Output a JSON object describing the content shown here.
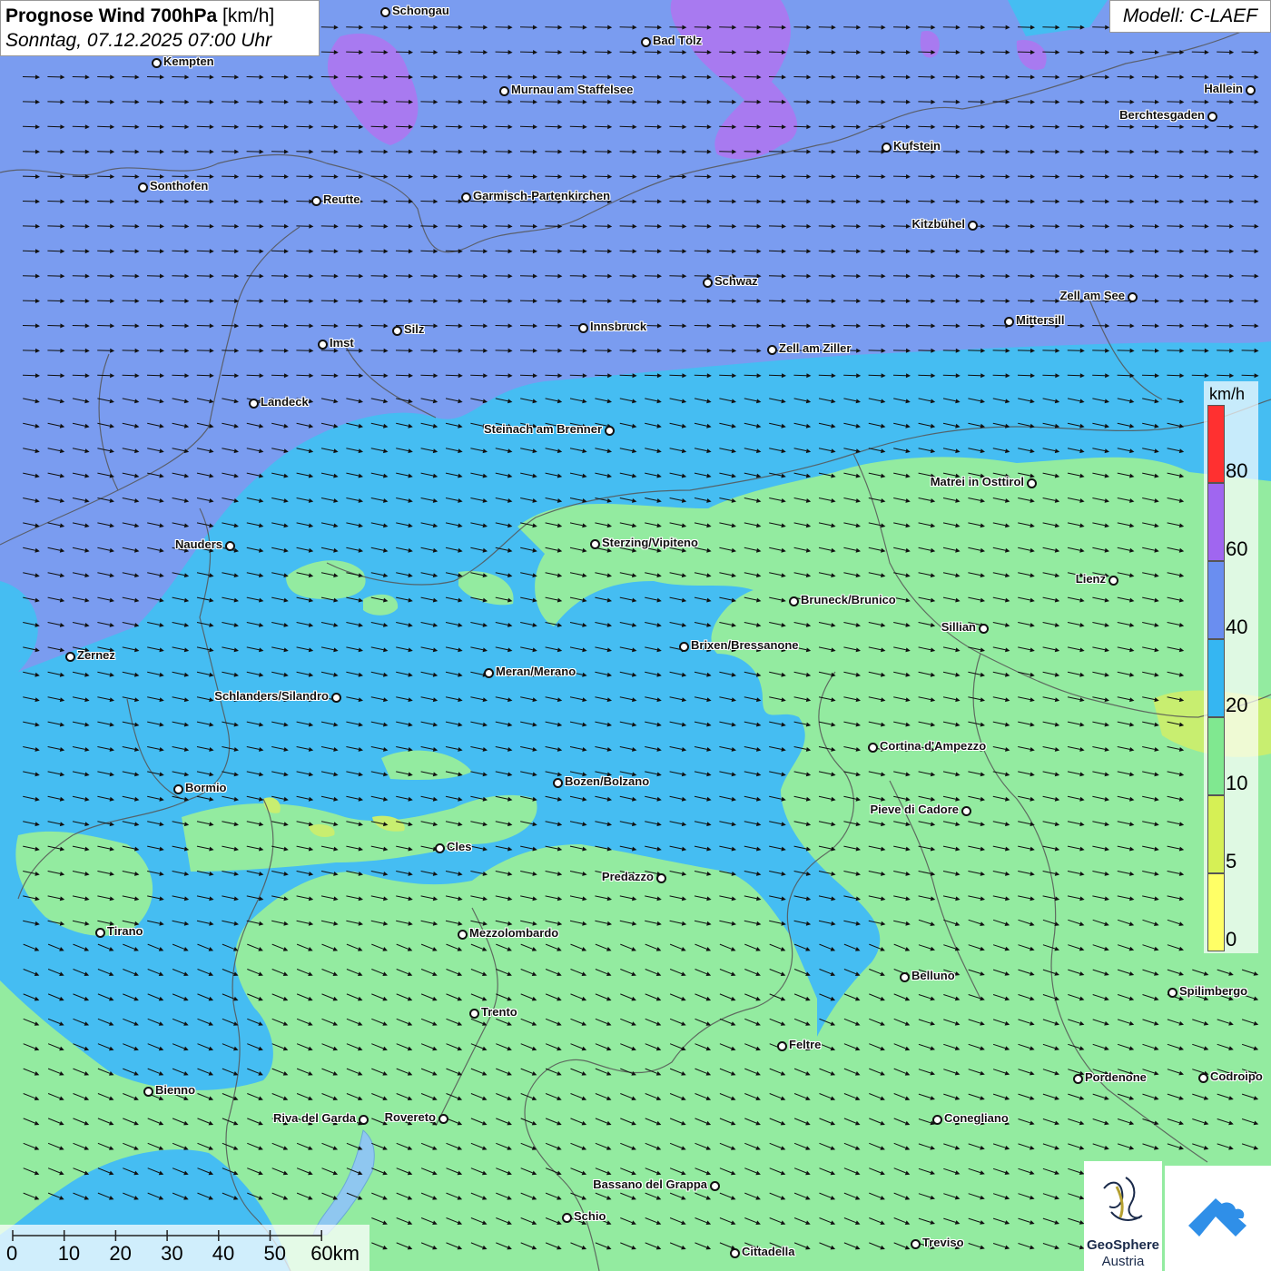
{
  "header": {
    "title_bold": "Prognose Wind 700hPa",
    "title_unit": "[km/h]",
    "datetime": "Sonntag, 07.12.2025 07:00 Uhr",
    "model": "Modell: C-LAEF"
  },
  "legend": {
    "unit": "km/h",
    "bins": [
      {
        "label": "80",
        "color": "#ff3030"
      },
      {
        "label": "60",
        "color": "#a066f0"
      },
      {
        "label": "40",
        "color": "#6a8ef0"
      },
      {
        "label": "20",
        "color": "#35b6f2"
      },
      {
        "label": "10",
        "color": "#80e890"
      },
      {
        "label": "5",
        "color": "#d6f055"
      },
      {
        "label": "0",
        "color": "#ffff66"
      }
    ]
  },
  "scale": {
    "labels": [
      "0",
      "10",
      "20",
      "30",
      "40",
      "50",
      "60km"
    ]
  },
  "logos": {
    "geosphere_line1": "GeoSphere",
    "geosphere_line2": "Austria"
  },
  "cities": [
    {
      "name": "Schongau"
    },
    {
      "name": "Bad Tölz"
    },
    {
      "name": "Kempten"
    },
    {
      "name": "Murnau am Staffelsee"
    },
    {
      "name": "Hallein"
    },
    {
      "name": "Berchtesgaden"
    },
    {
      "name": "Kufstein"
    },
    {
      "name": "Sonthofen"
    },
    {
      "name": "Reutte"
    },
    {
      "name": "Garmisch-Partenkirchen"
    },
    {
      "name": "Kitzbühel"
    },
    {
      "name": "Schwaz"
    },
    {
      "name": "Zell am See"
    },
    {
      "name": "Mittersill"
    },
    {
      "name": "Silz"
    },
    {
      "name": "Innsbruck"
    },
    {
      "name": "Imst"
    },
    {
      "name": "Zell am Ziller"
    },
    {
      "name": "Landeck"
    },
    {
      "name": "Steinach am Brenner"
    },
    {
      "name": "Matrei in Osttirol"
    },
    {
      "name": "Nauders"
    },
    {
      "name": "Sterzing/Vipiteno"
    },
    {
      "name": "Lienz"
    },
    {
      "name": "Bruneck/Brunico"
    },
    {
      "name": "Sillian"
    },
    {
      "name": "Brixen/Bressanone"
    },
    {
      "name": "Zernez"
    },
    {
      "name": "Meran/Merano"
    },
    {
      "name": "Schlanders/Silandro"
    },
    {
      "name": "Cortina d'Ampezzo"
    },
    {
      "name": "Bozen/Bolzano"
    },
    {
      "name": "Bormio"
    },
    {
      "name": "Pieve di Cadore"
    },
    {
      "name": "Cles"
    },
    {
      "name": "Predazzo"
    },
    {
      "name": "Tirano"
    },
    {
      "name": "Mezzolombardo"
    },
    {
      "name": "Belluno"
    },
    {
      "name": "Spilimbergo"
    },
    {
      "name": "Trento"
    },
    {
      "name": "Feltre"
    },
    {
      "name": "Pordenone"
    },
    {
      "name": "Codroipo"
    },
    {
      "name": "Bienno"
    },
    {
      "name": "Riva del Garda"
    },
    {
      "name": "Rovereto"
    },
    {
      "name": "Conegliano"
    },
    {
      "name": "Bassano del Grappa"
    },
    {
      "name": "Schio"
    },
    {
      "name": "Treviso"
    },
    {
      "name": "Cittadella"
    }
  ]
}
